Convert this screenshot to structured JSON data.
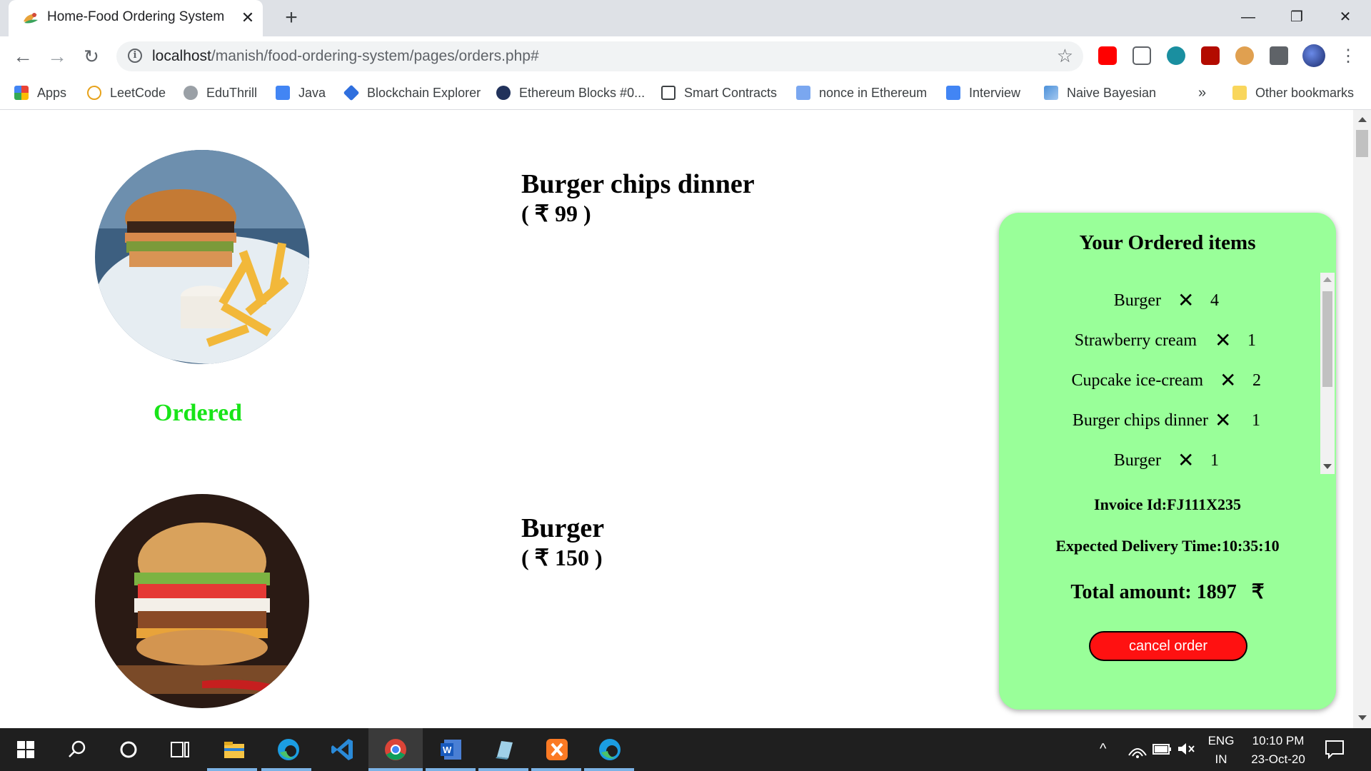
{
  "browser": {
    "tab_title": "Home-Food Ordering System",
    "url_host": "localhost",
    "url_path": "/manish/food-ordering-system/pages/orders.php#",
    "bookmarks": [
      {
        "label": "Apps"
      },
      {
        "label": "LeetCode"
      },
      {
        "label": "EduThrill"
      },
      {
        "label": "Java"
      },
      {
        "label": "Blockchain Explorer"
      },
      {
        "label": "Ethereum Blocks #0..."
      },
      {
        "label": "Smart Contracts"
      },
      {
        "label": "nonce in Ethereum"
      },
      {
        "label": "Interview"
      },
      {
        "label": "Naive Bayesian"
      }
    ],
    "overflow": "»",
    "other_bookmarks": "Other bookmarks"
  },
  "menu": {
    "items": [
      {
        "name": "Burger chips dinner",
        "price": "( ₹ 99 )",
        "status": "Ordered"
      },
      {
        "name": "Burger",
        "price": "( ₹ 150 )"
      }
    ]
  },
  "order_panel": {
    "title": "Your Ordered items",
    "items": [
      {
        "name": "Burger",
        "qty": "4"
      },
      {
        "name": "Strawberry cream",
        "qty": "1"
      },
      {
        "name": "Cupcake ice-cream",
        "qty": "2"
      },
      {
        "name": "Burger chips dinner",
        "qty": "1"
      },
      {
        "name": "Burger",
        "qty": "1"
      }
    ],
    "times_symbol": "✕",
    "invoice": "Invoice Id:FJ111X235",
    "delivery": "Expected Delivery Time:10:35:10",
    "total": "Total amount: 1897   ₹",
    "cancel_label": "cancel order"
  },
  "taskbar": {
    "language_top": "ENG",
    "language_bottom": "IN",
    "time": "10:10 PM",
    "date": "23-Oct-20"
  }
}
